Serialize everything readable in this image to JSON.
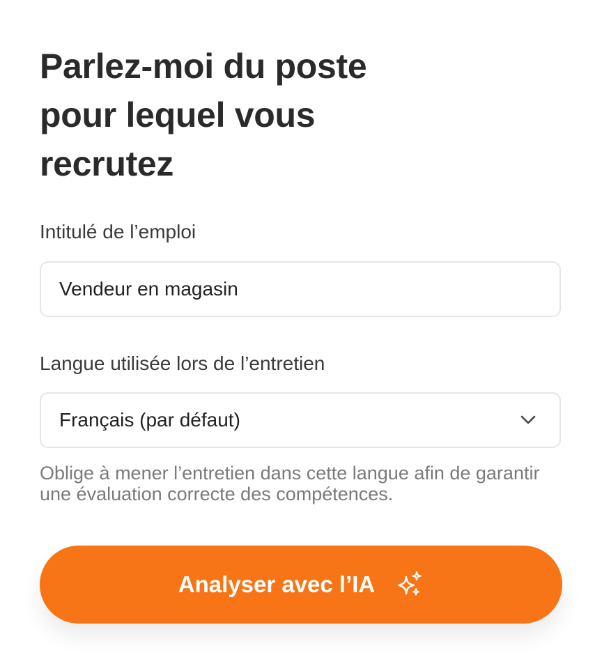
{
  "form": {
    "title": "Parlez-moi du poste pour lequel vous recrutez",
    "job_title_label": "Intitulé de l’emploi",
    "job_title_value": "Vendeur en magasin",
    "language_label": "Langue utilisée lors de l’entretien",
    "language_selected": "Français (par défaut)",
    "language_hint": "Oblige à mener l’entretien dans cette langue afin de garantir une évaluation correcte des compétences.",
    "submit_label": "Analyser avec l’IA"
  },
  "icons": {
    "dropdown": "chevron-down-icon",
    "submit": "sparkles-icon"
  },
  "colors": {
    "accent": "#f77516",
    "text": "#2a2a2a",
    "muted": "#7a7a7a",
    "border": "#e6e6e6"
  }
}
